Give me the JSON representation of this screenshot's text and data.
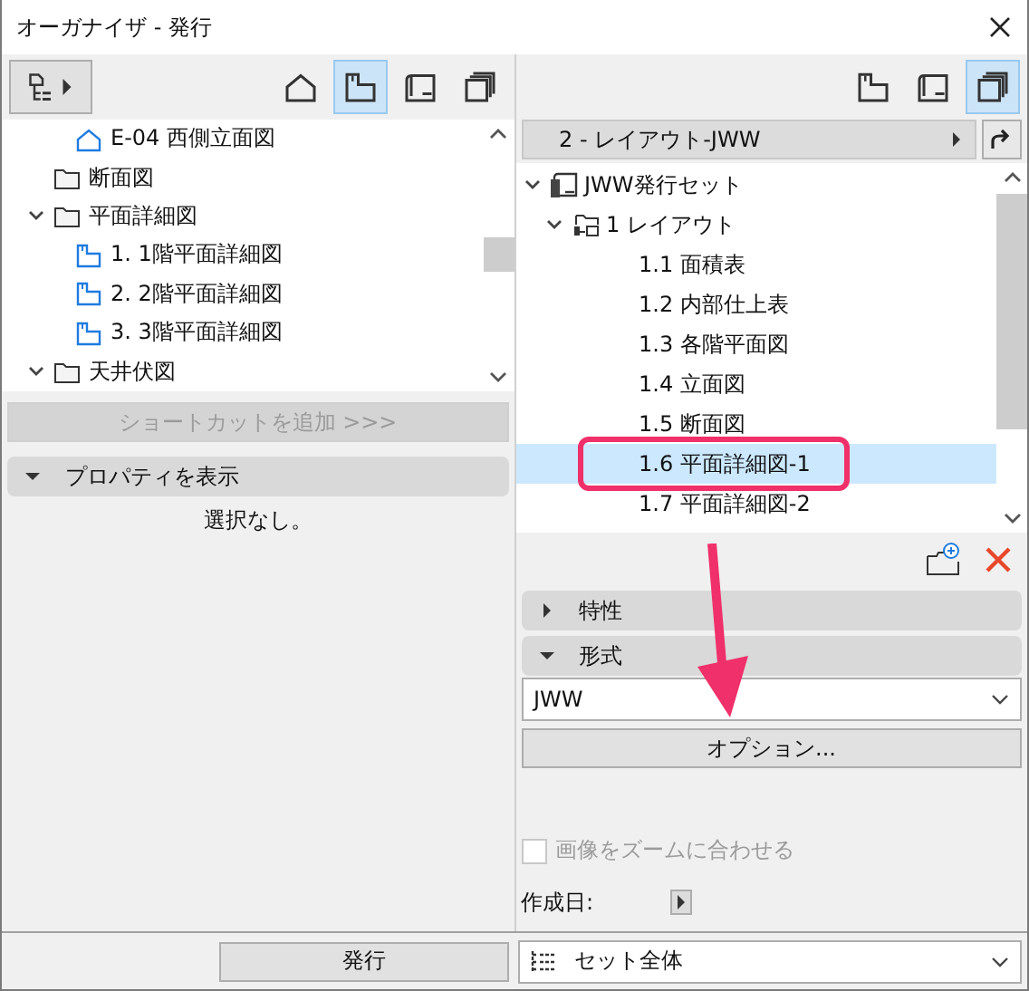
{
  "window": {
    "title": "オーガナイザ - 発行"
  },
  "left": {
    "views": [
      {
        "kind": "project",
        "selected": false
      },
      {
        "kind": "view",
        "selected": true
      },
      {
        "kind": "layout",
        "selected": false
      },
      {
        "kind": "publisher",
        "selected": false
      }
    ],
    "tree": [
      {
        "label": "E-04 西側立面図",
        "kind": "elevation",
        "selected": false
      },
      {
        "label": "断面図",
        "kind": "folder",
        "selected": false
      },
      {
        "label": "平面詳細図",
        "kind": "folder",
        "selected": false,
        "expanded": true,
        "children": [
          {
            "label": "1. 1階平面詳細図",
            "kind": "plan",
            "selected": false
          },
          {
            "label": "2. 2階平面詳細図",
            "kind": "plan",
            "selected": false
          },
          {
            "label": "3. 3階平面詳細図",
            "kind": "plan",
            "selected": false
          }
        ]
      },
      {
        "label": "天井伏図",
        "kind": "folder",
        "selected": false,
        "expanded": true
      }
    ],
    "shortcut_button": {
      "label": "ショートカットを追加 >>>",
      "disabled": true
    },
    "properties": {
      "label": "プロパティを表示",
      "expanded": true
    },
    "empty_text": "選択なし。"
  },
  "right": {
    "views": [
      {
        "kind": "view",
        "selected": false
      },
      {
        "kind": "layout",
        "selected": false
      },
      {
        "kind": "publisher",
        "selected": true
      }
    ],
    "layout_bar": {
      "label": "2 - レイアウト-JWW"
    },
    "tree": [
      {
        "label": "JWW発行セット",
        "kind": "set",
        "selected": false,
        "expanded": true,
        "children": [
          {
            "label": "1 レイアウト",
            "kind": "layout-folder",
            "selected": false,
            "expanded": true,
            "children": [
              {
                "label": "1.1 面積表",
                "selected": false
              },
              {
                "label": "1.2 内部仕上表",
                "selected": false
              },
              {
                "label": "1.3 各階平面図",
                "selected": false
              },
              {
                "label": "1.4 立面図",
                "selected": false
              },
              {
                "label": "1.5 断面図",
                "selected": false
              },
              {
                "label": "1.6 平面詳細図-1",
                "selected": true
              },
              {
                "label": "1.7 平面詳細図-2",
                "selected": false
              }
            ]
          }
        ]
      }
    ],
    "sections": [
      {
        "label": "特性",
        "expanded": false
      },
      {
        "label": "形式",
        "expanded": true
      }
    ],
    "format_select": {
      "value": "JWW"
    },
    "options_button": {
      "label": "オプション..."
    },
    "fit_zoom": {
      "label": "画像をズームに合わせる",
      "checked": false,
      "disabled": true
    },
    "created": {
      "label": "作成日:"
    }
  },
  "bottom": {
    "publish_button": {
      "label": "発行"
    },
    "scope_select": {
      "value": "セット全体"
    }
  }
}
